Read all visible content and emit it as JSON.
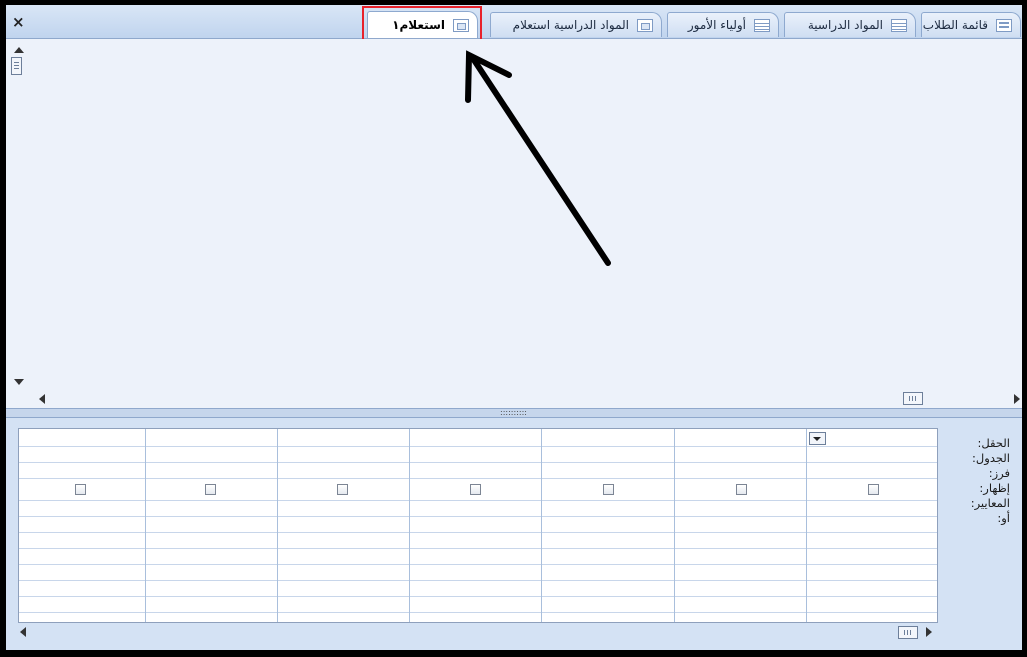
{
  "window": {
    "close_label": "×"
  },
  "tabs": [
    {
      "label": "قائمة الطلاب",
      "icon": "form-icon",
      "active": false
    },
    {
      "label": "المواد الدراسية",
      "icon": "table-icon",
      "active": false
    },
    {
      "label": "أولياء الأمور",
      "icon": "table-icon",
      "active": false
    },
    {
      "label": "المواد الدراسية استعلام",
      "icon": "query-icon",
      "active": false
    },
    {
      "label": "استعلام١",
      "icon": "query-icon",
      "active": true
    }
  ],
  "splitter": {
    "grip": "::::::::::"
  },
  "design_grid": {
    "row_labels": [
      "الحقل:",
      "الجدول:",
      "فرز:",
      "إظهار:",
      "المعايير:",
      "أو:"
    ],
    "column_count": 7
  },
  "colors": {
    "tab_highlight": "#e8222b",
    "upper_pane": "#edf2fa",
    "lower_pane": "#d4e2f4",
    "annotation_arrow": "#000000"
  }
}
